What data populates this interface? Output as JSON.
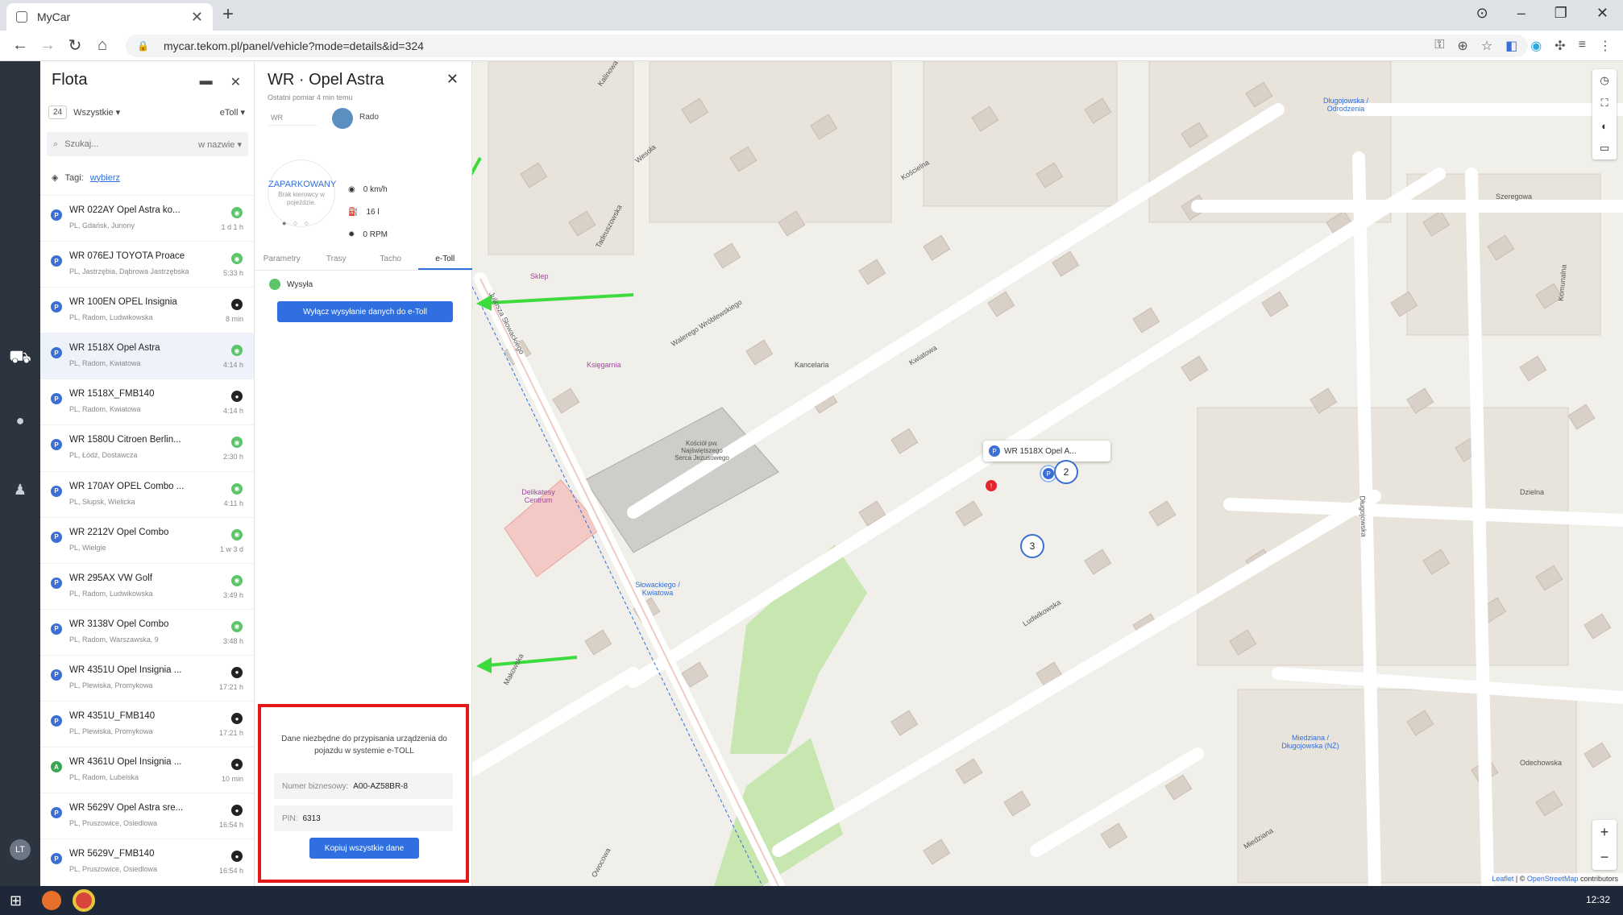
{
  "browser": {
    "tab_title": "MyCar",
    "url": "mycar.tekom.pl/panel/vehicle?mode=details&id=324"
  },
  "rail": {
    "avatar_initials": "LT"
  },
  "fleet": {
    "title": "Flota",
    "count": "24",
    "filter_all": "Wszystkie ▾",
    "filter_etoll": "eToll ▾",
    "search_placeholder": "Szukaj...",
    "search_scope": "w nazwie ▾",
    "tags_label": "Tagi:",
    "tags_link": "wybierz",
    "vehicles": [
      {
        "name": "WR 022AY Opel Astra ko...",
        "location": "PL, Gdańsk, Junony",
        "time": "1 d 1 h",
        "status": "green",
        "pin": "P"
      },
      {
        "name": "WR 076EJ TOYOTA Proace",
        "location": "PL, Jastrzębia, Dąbrowa Jastrzębska",
        "time": "5:33 h",
        "status": "green",
        "pin": "P"
      },
      {
        "name": "WR 100EN OPEL Insignia",
        "location": "PL, Radom, Ludwikowska",
        "time": "8 min",
        "status": "black",
        "pin": "P"
      },
      {
        "name": "WR 1518X Opel Astra",
        "location": "PL, Radom, Kwiatowa",
        "time": "4:14 h",
        "status": "green",
        "pin": "P"
      },
      {
        "name": "WR 1518X_FMB140",
        "location": "PL, Radom, Kwiatowa",
        "time": "4:14 h",
        "status": "black",
        "pin": "P"
      },
      {
        "name": "WR 1580U Citroen Berlin...",
        "location": "PL, Łódź, Dostawcza",
        "time": "2:30 h",
        "status": "green",
        "pin": "P"
      },
      {
        "name": "WR 170AY OPEL Combo ...",
        "location": "PL, Słupsk, Wielicka",
        "time": "4:11 h",
        "status": "green",
        "pin": "P"
      },
      {
        "name": "WR 2212V Opel Combo",
        "location": "PL, Wielgie",
        "time": "1 w 3 d",
        "status": "green",
        "pin": "P"
      },
      {
        "name": "WR 295AX VW Golf",
        "location": "PL, Radom, Ludwikowska",
        "time": "3:49 h",
        "status": "green",
        "pin": "P"
      },
      {
        "name": "WR 3138V Opel Combo",
        "location": "PL, Radom, Warszawska, 9",
        "time": "3:48 h",
        "status": "green",
        "pin": "P"
      },
      {
        "name": "WR 4351U Opel Insignia ...",
        "location": "PL, Plewiska, Promykowa",
        "time": "17:21 h",
        "status": "black",
        "pin": "P"
      },
      {
        "name": "WR 4351U_FMB140",
        "location": "PL, Plewiska, Promykowa",
        "time": "17:21 h",
        "status": "black",
        "pin": "P"
      },
      {
        "name": "WR 4361U Opel Insignia ...",
        "location": "PL, Radom, Lubelska",
        "time": "10 min",
        "status": "black",
        "pin": "A"
      },
      {
        "name": "WR 5629V Opel Astra sre...",
        "location": "PL, Pruszowice, Osiedlowa",
        "time": "16:54 h",
        "status": "black",
        "pin": "P"
      },
      {
        "name": "WR 5629V_FMB140",
        "location": "PL, Pruszowice, Osiedlowa",
        "time": "16:54 h",
        "status": "black",
        "pin": "P"
      }
    ]
  },
  "detail": {
    "title": "WR ·       Opel Astra",
    "subtitle": "Ostatni pomiar 4 min temu",
    "plate": "WR",
    "driver": "Rado",
    "status_label": "ZAPARKOWANY",
    "status_desc": "Brak kierowcy w pojeździe.",
    "status_dots": "● ○ ○",
    "speed": "0 km/h",
    "fuel": "16 l",
    "rpm": "0 RPM",
    "tabs": [
      "Parametry",
      "Trasy",
      "Tacho",
      "e-Toll"
    ],
    "etoll_state": "Wysyła",
    "disable_button": "Wyłącz wysyłanie danych do e-Toll",
    "assign_desc": "Dane niezbędne do przypisania urządzenia do pojazdu w systemie e-TOLL",
    "business_label": "Numer biznesowy:",
    "business_value": "A00-AZ58BR-8",
    "pin_label": "PIN:",
    "pin_value": "6313",
    "copy_button": "Kopiuj wszystkie dane"
  },
  "map": {
    "popup_label": "WR 1518X Opel A...",
    "cluster_a": "2",
    "cluster_b": "3",
    "red_marker": "!",
    "car_marker": "P",
    "attribution_leaflet": "Leaflet",
    "attribution_osm": "OpenStreetMap",
    "attribution_tail": "contributors",
    "streets": [
      "Juliusza Słowackiego",
      "Walerego Wróblewskiego",
      "Kościelna",
      "Kwiatowa",
      "Ludwikowska",
      "Długojowska",
      "Szeregowa",
      "Dzielna",
      "Odechowska",
      "Miedziana",
      "Tadeuszowska",
      "Wesoła",
      "Makowska",
      "Kalinowa",
      "Komunalna",
      "Owocowa"
    ],
    "pois": [
      "Sklep",
      "Księgarnia",
      "Kancelaria",
      "Kościół pw. Najświętszego Serca Jezusowego",
      "Delikatesy Centrum",
      "Słowackiego / Kwiatowa",
      "Długojowska / Odrodzenia",
      "Miedziana / Długojowska (NŻ)"
    ]
  },
  "taskbar": {
    "time": "12:32"
  },
  "colors": {
    "accent": "#2f6fe0",
    "rail": "#2c3440",
    "highlight_box": "#e31818",
    "status_green": "#5cc56a",
    "arrow_green": "#3ddc3d"
  }
}
